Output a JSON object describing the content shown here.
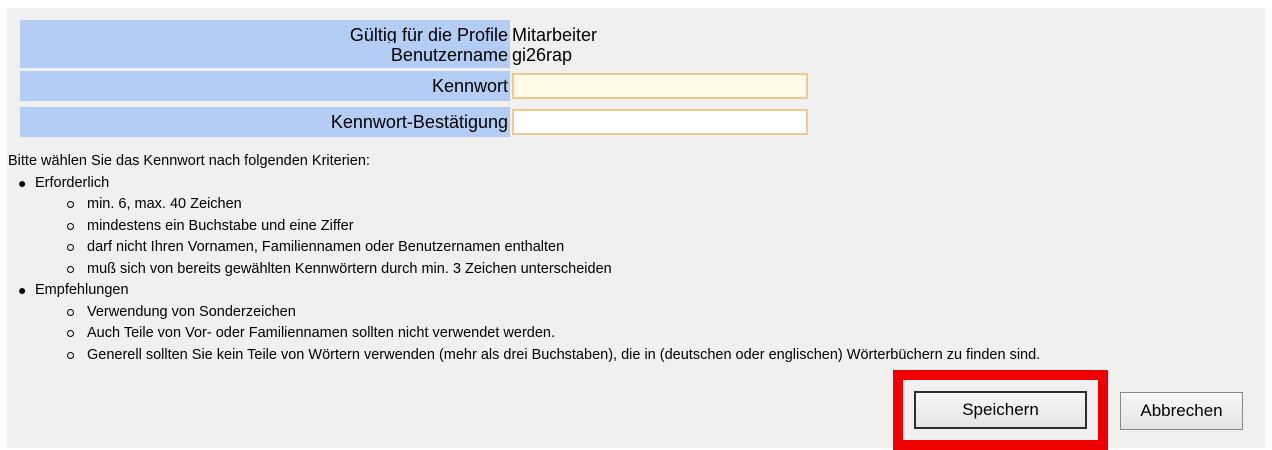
{
  "form": {
    "profiles_label": "Gültig für die Profile",
    "profiles_value": "Mitarbeiter",
    "username_label": "Benutzername",
    "username_value": "gi26rap",
    "password_label": "Kennwort",
    "password_value": "",
    "confirm_label": "Kennwort-Bestätigung",
    "confirm_value": ""
  },
  "criteria": {
    "intro": "Bitte wählen Sie das Kennwort nach folgenden Kriterien:",
    "required_label": "Erforderlich",
    "required_items": [
      "min. 6, max. 40 Zeichen",
      "mindestens ein Buchstabe und eine Ziffer",
      "darf nicht Ihren Vornamen, Familiennamen oder Benutzernamen enthalten",
      "muß sich von bereits gewählten Kennwörtern durch min. 3 Zeichen unterscheiden"
    ],
    "recommended_label": "Empfehlungen",
    "recommended_items": [
      "Verwendung von Sonderzeichen",
      "Auch Teile von Vor- oder Familiennamen sollten nicht verwendet werden.",
      "Generell sollten Sie kein Teile von Wörtern verwenden (mehr als drei Buchstaben), die in (deutschen oder englischen) Wörterbüchern zu finden sind."
    ]
  },
  "buttons": {
    "save": "Speichern",
    "cancel": "Abbrechen"
  },
  "colors": {
    "label_bg": "#b4cdf5",
    "panel_bg": "#f0f0f0",
    "input_border": "#f1c98e",
    "highlight": "#ee0000"
  }
}
